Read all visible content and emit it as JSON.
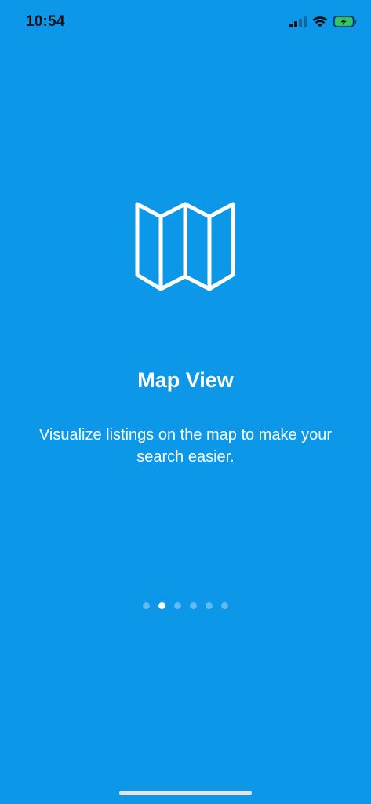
{
  "status_bar": {
    "time": "10:54",
    "icons": [
      "cellular-signal-icon",
      "wifi-icon",
      "battery-charging-icon"
    ]
  },
  "onboarding": {
    "icon": "map-icon",
    "title": "Map View",
    "description": "Visualize listings on the map to make your search easier.",
    "page_indicator": {
      "total_pages": 6,
      "current_page": 2
    }
  },
  "colors": {
    "background": "#0C97E8",
    "text": "#FFFFFF",
    "battery_fill": "#34C759"
  }
}
